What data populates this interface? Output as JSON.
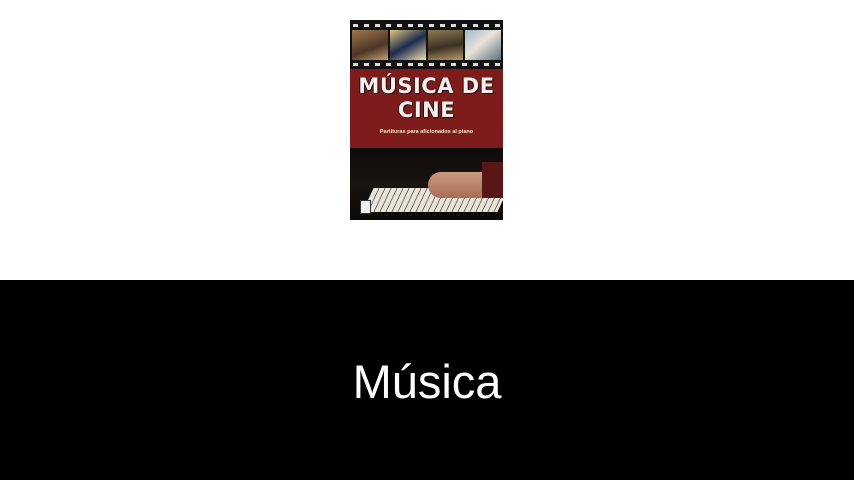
{
  "cover": {
    "title_line1": "MÚSICA DE",
    "title_line2": "CINE",
    "subtitle": "Partituras para aficionados al piano"
  },
  "band": {
    "title": "Música"
  },
  "colors": {
    "band_background": "#000000",
    "cover_red": "#7e1c1c"
  }
}
